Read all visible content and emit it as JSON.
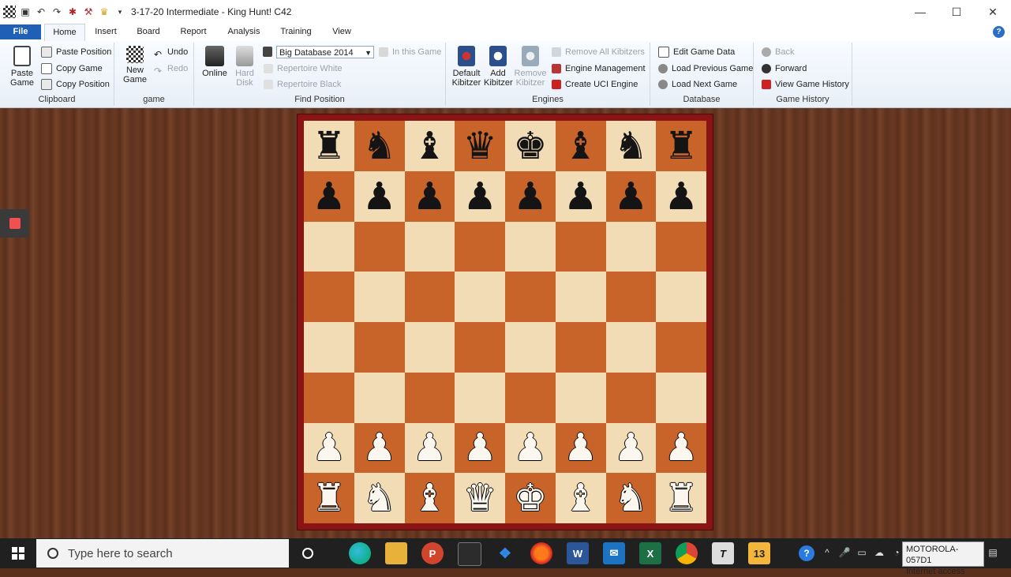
{
  "window": {
    "title": "3-17-20 Intermediate - King Hunt!  C42"
  },
  "tabs": [
    "File",
    "Home",
    "Insert",
    "Board",
    "Report",
    "Analysis",
    "Training",
    "View"
  ],
  "active_tab": "Home",
  "ribbon": {
    "clipboard": {
      "label": "Clipboard",
      "paste_game": "Paste Game",
      "paste_position": "Paste Position",
      "copy_game": "Copy Game",
      "copy_position": "Copy Position"
    },
    "game": {
      "label": "game",
      "new_game": "New Game",
      "undo": "Undo",
      "redo": "Redo"
    },
    "find_position": {
      "label": "Find Position",
      "online": "Online",
      "hard_disk": "Hard Disk",
      "database_select": "Big Database 2014",
      "in_this_game": "In this Game",
      "repertoire_white": "Repertoire White",
      "repertoire_black": "Repertoire Black"
    },
    "engines": {
      "label": "Engines",
      "default_kibitzer": "Default Kibitzer",
      "add_kibitzer": "Add Kibitzer",
      "remove_kibitzer": "Remove Kibitzer",
      "remove_all_kibitzers": "Remove All Kibitzers",
      "engine_management": "Engine Management",
      "create_uci_engine": "Create UCI Engine"
    },
    "database": {
      "label": "Database",
      "edit_game_data": "Edit Game Data",
      "load_previous_game": "Load Previous Game",
      "load_next_game": "Load Next Game"
    },
    "game_history": {
      "label": "Game History",
      "back": "Back",
      "forward": "Forward",
      "view_game_history": "View Game History"
    }
  },
  "board": {
    "rows": [
      [
        "bR",
        "bN",
        "bB",
        "bQ",
        "bK",
        "bB",
        "bN",
        "bR"
      ],
      [
        "bP",
        "bP",
        "bP",
        "bP",
        "bP",
        "bP",
        "bP",
        "bP"
      ],
      [
        "",
        "",
        "",
        "",
        "",
        "",
        "",
        ""
      ],
      [
        "",
        "",
        "",
        "",
        "",
        "",
        "",
        ""
      ],
      [
        "",
        "",
        "",
        "",
        "",
        "",
        "",
        ""
      ],
      [
        "",
        "",
        "",
        "",
        "",
        "",
        "",
        ""
      ],
      [
        "wP",
        "wP",
        "wP",
        "wP",
        "wP",
        "wP",
        "wP",
        "wP"
      ],
      [
        "wR",
        "wN",
        "wB",
        "wQ",
        "wK",
        "wB",
        "wN",
        "wR"
      ]
    ],
    "glyphs": {
      "R": "♜",
      "N": "♞",
      "B": "♝",
      "Q": "♛",
      "K": "♚",
      "P": "♟"
    }
  },
  "taskbar": {
    "search_placeholder": "Type here to search",
    "app13_label": "13",
    "network_tooltip": {
      "name": "MOTOROLA-057D1",
      "status": "Internet access"
    }
  },
  "colors": {
    "accent": "#1f5fb5",
    "board_light": "#f1dcb5",
    "board_dark": "#c8642a",
    "frame": "#8a1414"
  }
}
